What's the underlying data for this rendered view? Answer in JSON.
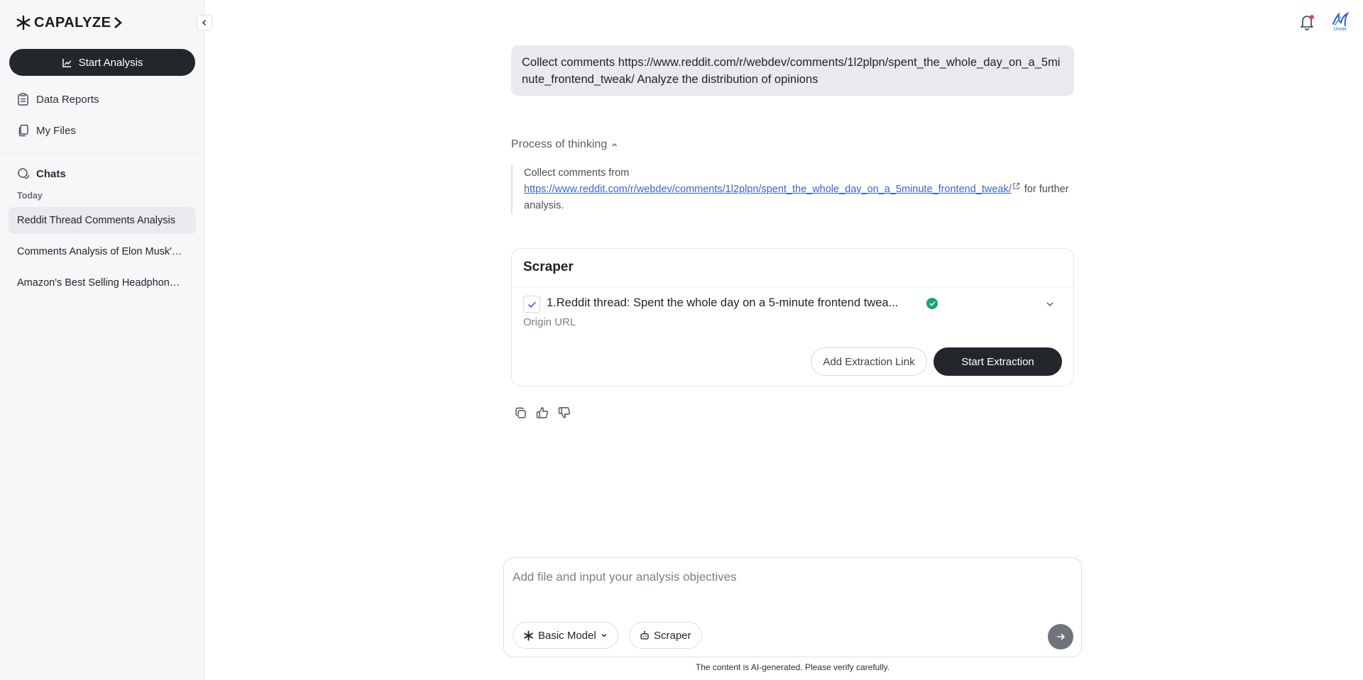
{
  "brand": {
    "name": "CAPALYZE"
  },
  "sidebar": {
    "start_analysis": "Start Analysis",
    "nav": [
      {
        "label": "Data Reports",
        "icon": "clipboard-icon"
      },
      {
        "label": "My Files",
        "icon": "files-icon"
      }
    ],
    "chats_heading": "Chats",
    "today_label": "Today",
    "chats": [
      {
        "label": "Reddit Thread Comments Analysis"
      },
      {
        "label": "Comments Analysis of Elon Musk's Tweet"
      },
      {
        "label": "Amazon's Best Selling Headphones Analysis"
      }
    ]
  },
  "header": {
    "avatar_label": "Unver"
  },
  "conversation": {
    "user_message": "Collect comments https://www.reddit.com/r/webdev/comments/1l2plpn/spent_the_whole_day_on_a_5minute_frontend_tweak/ Analyze the distribution of opinions",
    "thinking_label": "Process of thinking",
    "thinking_prefix": "Collect comments from",
    "thinking_link": "https://www.reddit.com/r/webdev/comments/1l2plpn/spent_the_whole_day_on_a_5minute_frontend_tweak/",
    "thinking_suffix": "for further analysis."
  },
  "scraper_card": {
    "title": "Scraper",
    "item_title": "1.Reddit thread: Spent the whole day on a 5-minute frontend twea...",
    "origin_label": "Origin URL",
    "add_link_label": "Add Extraction Link",
    "start_label": "Start Extraction"
  },
  "composer": {
    "placeholder": "Add file and input your analysis objectives",
    "model_label": "Basic Model",
    "scraper_label": "Scraper"
  },
  "footer": {
    "disclaimer": "The content is AI-generated. Please verify carefully."
  },
  "colors": {
    "dark_button": "#23262b",
    "success": "#17a56b",
    "link": "#3b63d6",
    "bubble": "#e8eaed"
  }
}
